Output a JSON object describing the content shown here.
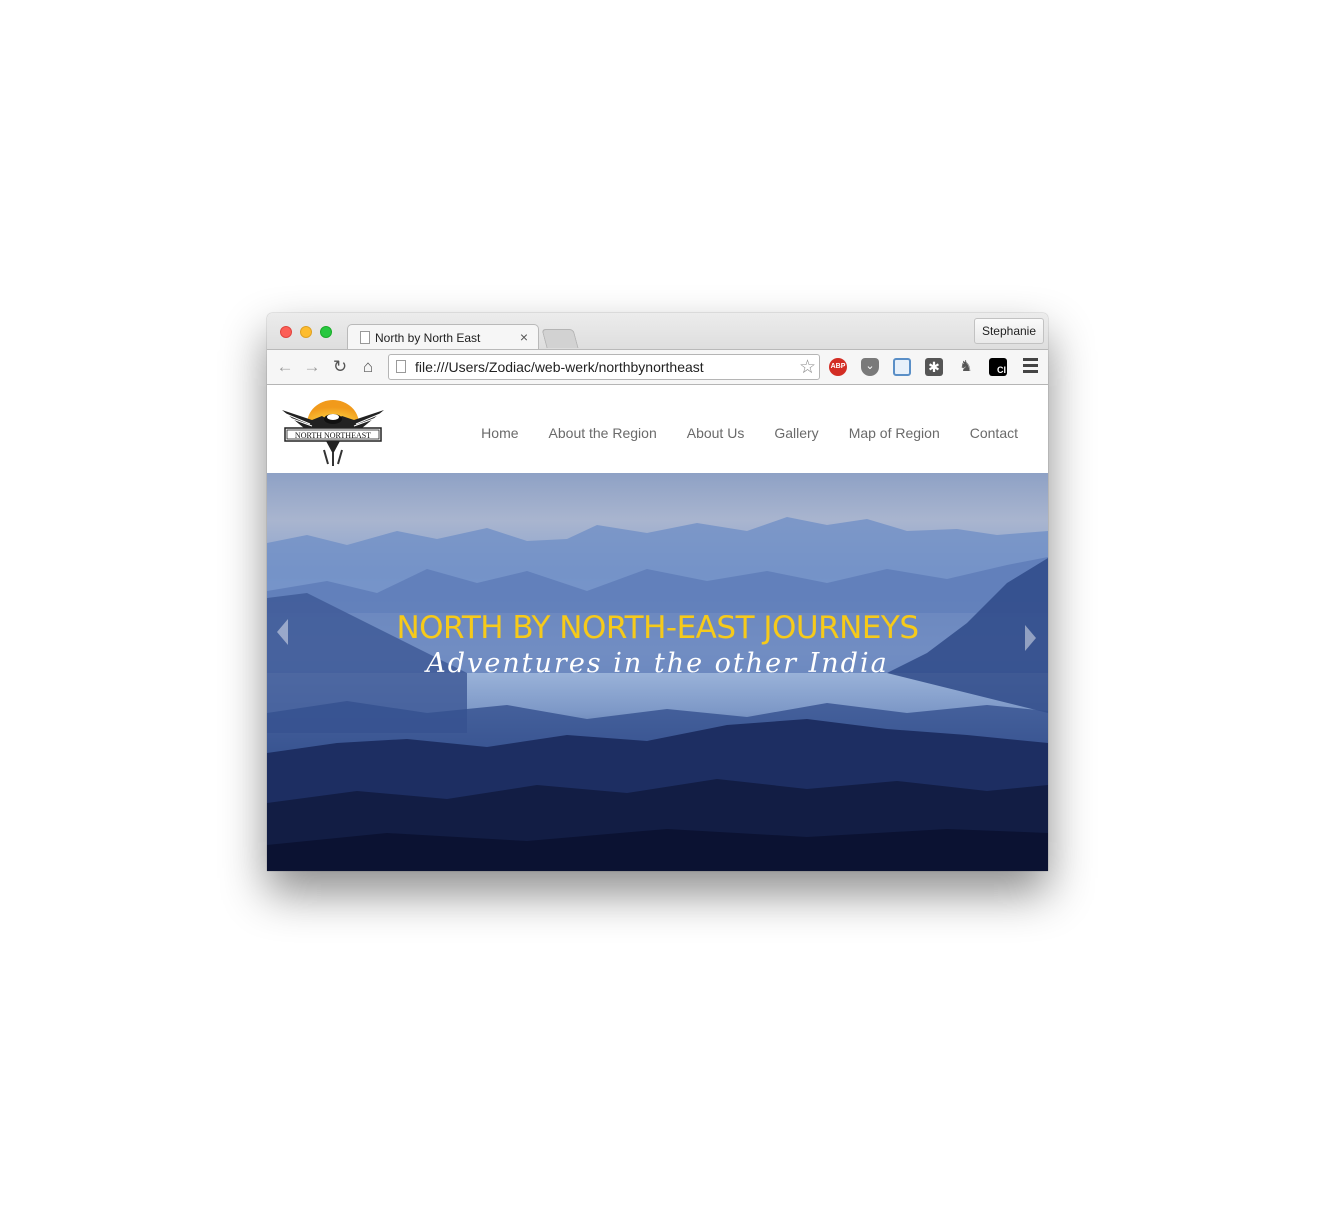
{
  "browser": {
    "tab_title": "North by North East",
    "tab_close": "×",
    "profile_name": "Stephanie",
    "url": "file:///Users/Zodiac/web-werk/northbynortheast",
    "extensions": [
      {
        "name": "adblock-plus-icon",
        "label": "ABP"
      },
      {
        "name": "pocket-icon",
        "label": ""
      },
      {
        "name": "screen-capture-icon",
        "label": ""
      },
      {
        "name": "puzzle-extension-icon",
        "label": ""
      },
      {
        "name": "evernote-icon",
        "label": ""
      },
      {
        "name": "ci-extension-icon",
        "label": "CI"
      }
    ]
  },
  "site": {
    "logo_text": "NORTH NORTHEAST",
    "nav": [
      {
        "label": "Home"
      },
      {
        "label": "About the Region"
      },
      {
        "label": "About Us"
      },
      {
        "label": "Gallery"
      },
      {
        "label": "Map of Region"
      },
      {
        "label": "Contact"
      }
    ],
    "hero": {
      "title": "NORTH BY NORTH-EAST JOURNEYS",
      "subtitle": "Adventures in the other India",
      "title_color": "#f6ca1a"
    }
  }
}
